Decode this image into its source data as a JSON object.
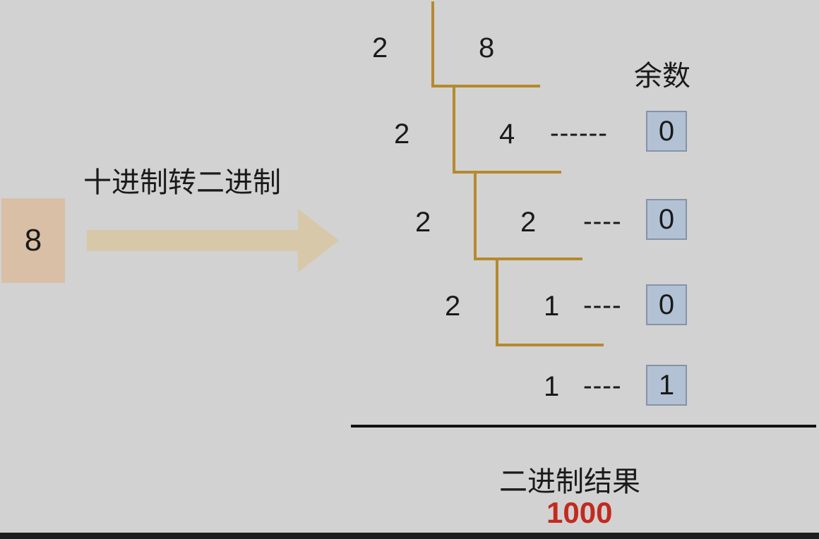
{
  "input": {
    "decimal_value": "8"
  },
  "conversion_label": "十进制转二进制",
  "remainder_header": "余数",
  "steps": [
    {
      "divisor": "2",
      "dividend": "8"
    },
    {
      "divisor": "2",
      "dividend": "4",
      "dashes": "------",
      "remainder": "0"
    },
    {
      "divisor": "2",
      "dividend": "2",
      "dashes": "----",
      "remainder": "0"
    },
    {
      "divisor": "2",
      "dividend": "1",
      "dashes": "----",
      "remainder": "0"
    },
    {
      "dividend": "1",
      "dashes": "----",
      "remainder": "1"
    }
  ],
  "result": {
    "label": "二进制结果",
    "value": "1000"
  },
  "colors": {
    "background": "#d2d2d2",
    "input_box": "#d9bfa6",
    "arrow": "#d6c8a9",
    "division_lines": "#b58a2e",
    "remainder_box": "#b3c1d4",
    "result_value": "#c22a1f",
    "separator": "#111111"
  }
}
